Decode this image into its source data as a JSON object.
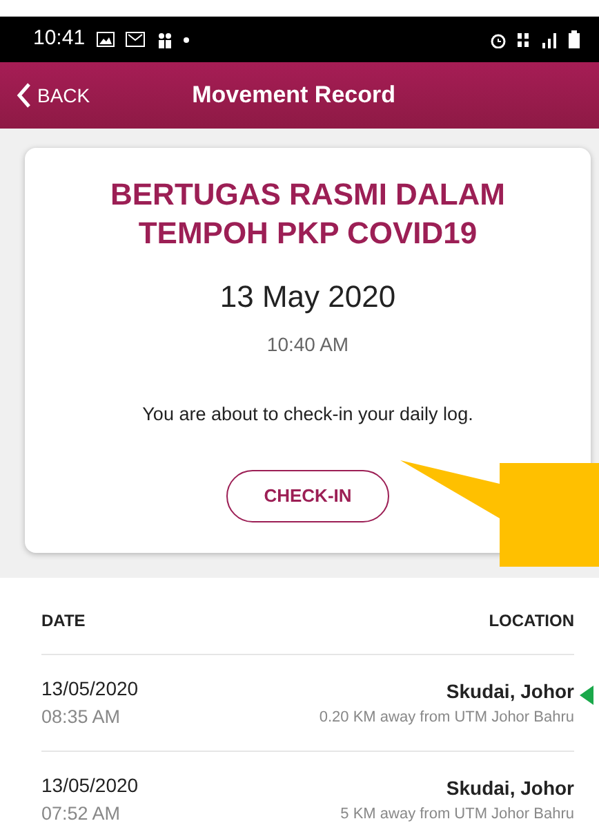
{
  "status_bar": {
    "time": "10:41"
  },
  "header": {
    "back": "BACK",
    "title": "Movement Record"
  },
  "card": {
    "title": "BERTUGAS RASMI DALAM TEMPOH PKP COVID19",
    "date": "13 May 2020",
    "time": "10:40 AM",
    "message": "You are about to check-in your daily log.",
    "button": "CHECK-IN"
  },
  "table": {
    "columns": [
      "DATE",
      "LOCATION"
    ],
    "rows": [
      {
        "date": "13/05/2020",
        "time": "08:35 AM",
        "location": "Skudai, Johor",
        "distance": "0.20 KM away from UTM Johor Bahru",
        "marked": true
      },
      {
        "date": "13/05/2020",
        "time": "07:52 AM",
        "location": "Skudai, Johor",
        "distance": "5 KM away from UTM Johor Bahru",
        "marked": false
      }
    ]
  }
}
